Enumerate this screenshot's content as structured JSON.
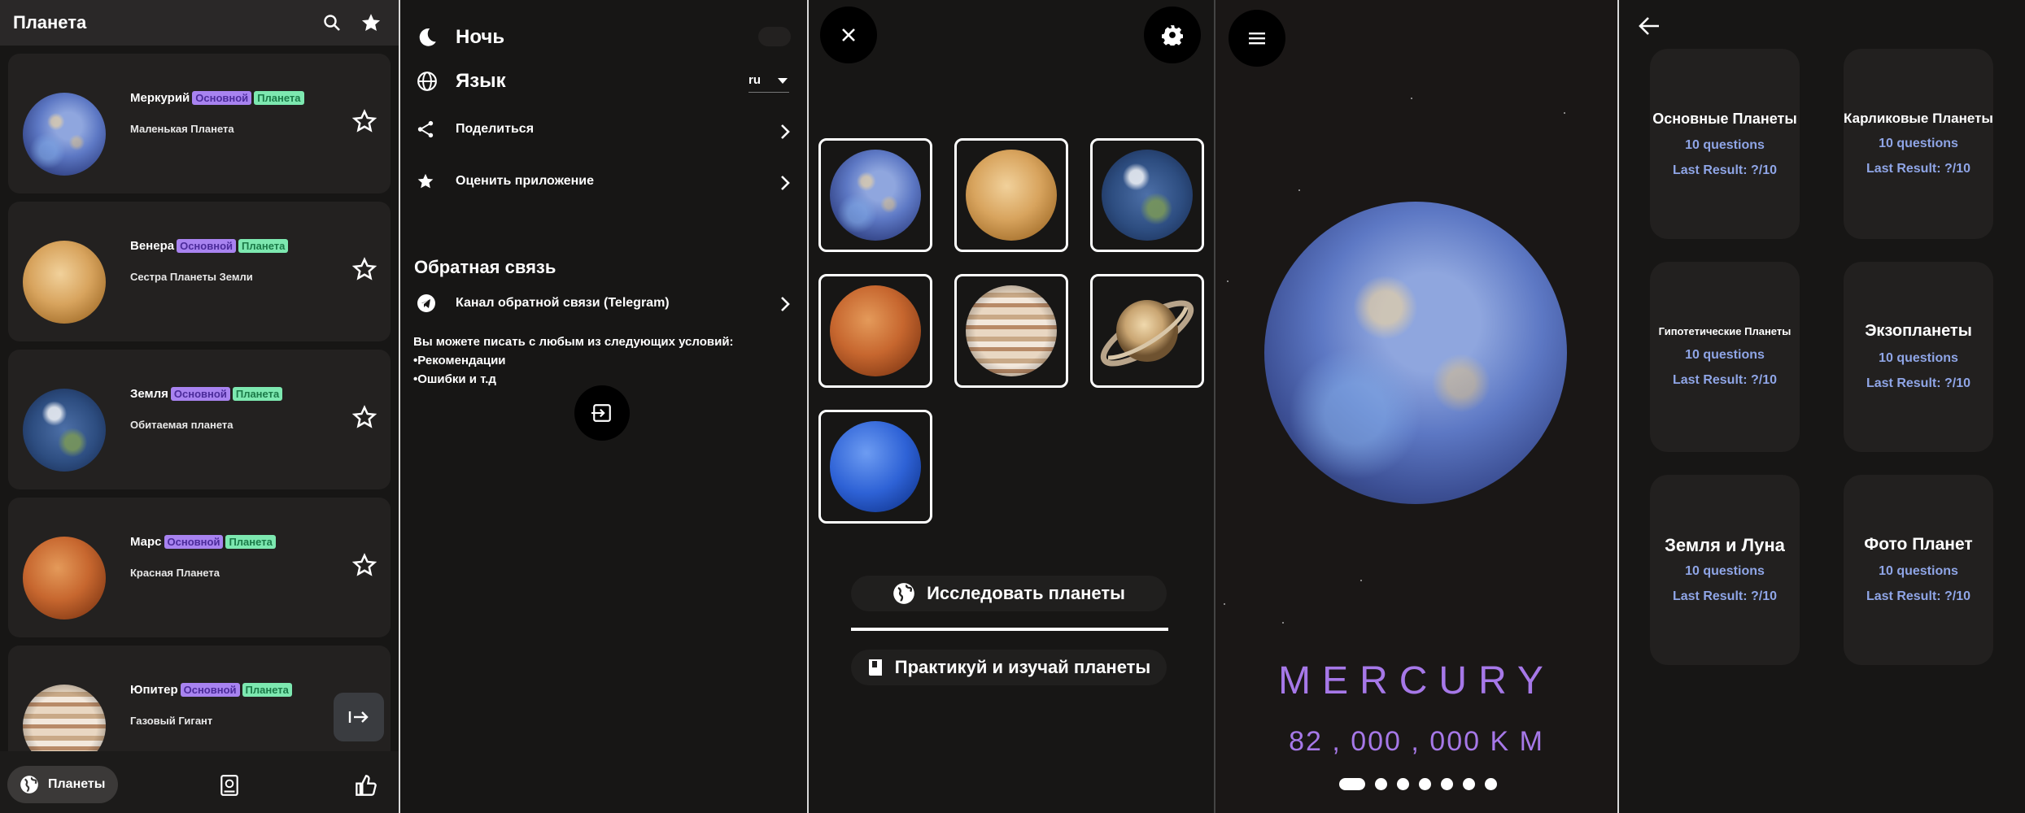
{
  "panel1": {
    "title": "Планета",
    "planets": [
      {
        "name": "Меркурий",
        "badge_main": "Основной",
        "badge_type": "Планета",
        "desc": "Маленькая Планета"
      },
      {
        "name": "Венера",
        "badge_main": "Основной",
        "badge_type": "Планета",
        "desc": "Сестра Планеты Земли"
      },
      {
        "name": "Земля",
        "badge_main": "Основной",
        "badge_type": "Планета",
        "desc": "Обитаемая планета"
      },
      {
        "name": "Марс",
        "badge_main": "Основной",
        "badge_type": "Планета",
        "desc": "Красная Планета"
      },
      {
        "name": "Юпитер",
        "badge_main": "Основной",
        "badge_type": "Планета",
        "desc": "Газовый Гигант"
      }
    ],
    "nav_active_label": "Планеты"
  },
  "panel2": {
    "night_label": "Ночь",
    "language_label": "Язык",
    "language_value": "ru",
    "share_label": "Поделиться",
    "rate_label": "Оценить приложение",
    "feedback_title": "Обратная связь",
    "telegram_label": "Канал обратной связи (Telegram)",
    "feedback_text": "Вы можете писать с любым из следующих условий:",
    "feedback_item1": "•Рекомендации",
    "feedback_item2": "•Ошибки и т.д"
  },
  "panel3": {
    "explore_label": "Исследовать планеты",
    "practice_label": "Практикуй и изучай планеты"
  },
  "panel4": {
    "planet_name": "MERCURY",
    "distance": "82 , 000 , 000 K M",
    "page_count": 7,
    "active_page": 1
  },
  "panel5": {
    "quizzes": [
      {
        "title": "Основные Планеты",
        "questions": "10 questions",
        "result": "Last Result: ?/10"
      },
      {
        "title": "Карликовые Планеты",
        "questions": "10 questions",
        "result": "Last Result: ?/10"
      },
      {
        "title": "Гипотетические Планеты",
        "questions": "10 questions",
        "result": "Last Result: ?/10"
      },
      {
        "title": "Экзопланеты",
        "questions": "10 questions",
        "result": "Last Result: ?/10"
      },
      {
        "title": "Земля и Луна",
        "questions": "10 questions",
        "result": "Last Result: ?/10"
      },
      {
        "title": "Фото Планет",
        "questions": "10 questions",
        "result": "Last Result: ?/10"
      }
    ]
  },
  "colors": {
    "accent_purple": "#a678e8",
    "badge_main": "#a883f0",
    "badge_planet": "#7de8b0",
    "quiz_link": "#8fa5e6"
  },
  "icons": [
    "search-icon",
    "star-icon",
    "moon-icon",
    "globe-icon",
    "share-icon",
    "telegram-icon",
    "chevron-right-icon",
    "logout-icon",
    "close-icon",
    "gear-icon",
    "menu-icon",
    "back-arrow-icon",
    "book-icon",
    "thumbs-up-icon",
    "explore-icon"
  ]
}
